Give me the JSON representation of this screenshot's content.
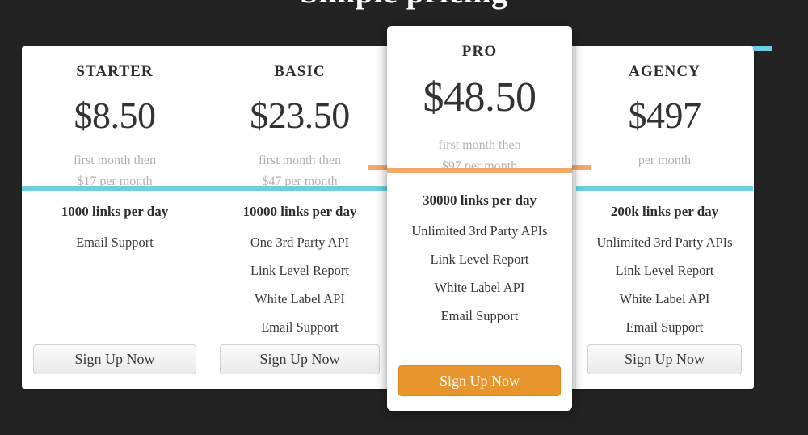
{
  "heading": "Simple pricing",
  "colors": {
    "background": "#232323",
    "card": "#ffffff",
    "divider_cyan": "#6ecfe0",
    "divider_orange": "#f4a96a",
    "button_orange": "#e8952e",
    "price_text": "#333333",
    "note_text": "#b2b2b2"
  },
  "plans": [
    {
      "name": "STARTER",
      "price": "$8.50",
      "note_line1": "first month then",
      "note_line2": "$17 per month",
      "divider_color": "#6ecfe0",
      "feature_head": "1000 links per day",
      "features": [
        "Email Support"
      ],
      "cta": "Sign Up Now",
      "featured": false
    },
    {
      "name": "BASIC",
      "price": "$23.50",
      "note_line1": "first month then",
      "note_line2": "$47 per month",
      "divider_color": "#6ecfe0",
      "feature_head": "10000 links per day",
      "features": [
        "One 3rd Party API",
        "Link Level Report",
        "White Label API",
        "Email Support"
      ],
      "cta": "Sign Up Now",
      "featured": false
    },
    {
      "name": "PRO",
      "price": "$48.50",
      "note_line1": "first month then",
      "note_line2": "$97 per month",
      "divider_color": "#f4a96a",
      "feature_head": "30000 links per day",
      "features": [
        "Unlimited 3rd Party APIs",
        "Link Level Report",
        "White Label API",
        "Email Support"
      ],
      "cta": "Sign Up Now",
      "featured": true
    },
    {
      "name": "AGENCY",
      "price": "$497",
      "note_line1": "per month",
      "note_line2": "",
      "divider_color": "#6ecfe0",
      "feature_head": "200k links per day",
      "features": [
        "Unlimited 3rd Party APIs",
        "Link Level Report",
        "White Label API",
        "Email Support"
      ],
      "cta": "Sign Up Now",
      "featured": false
    }
  ]
}
